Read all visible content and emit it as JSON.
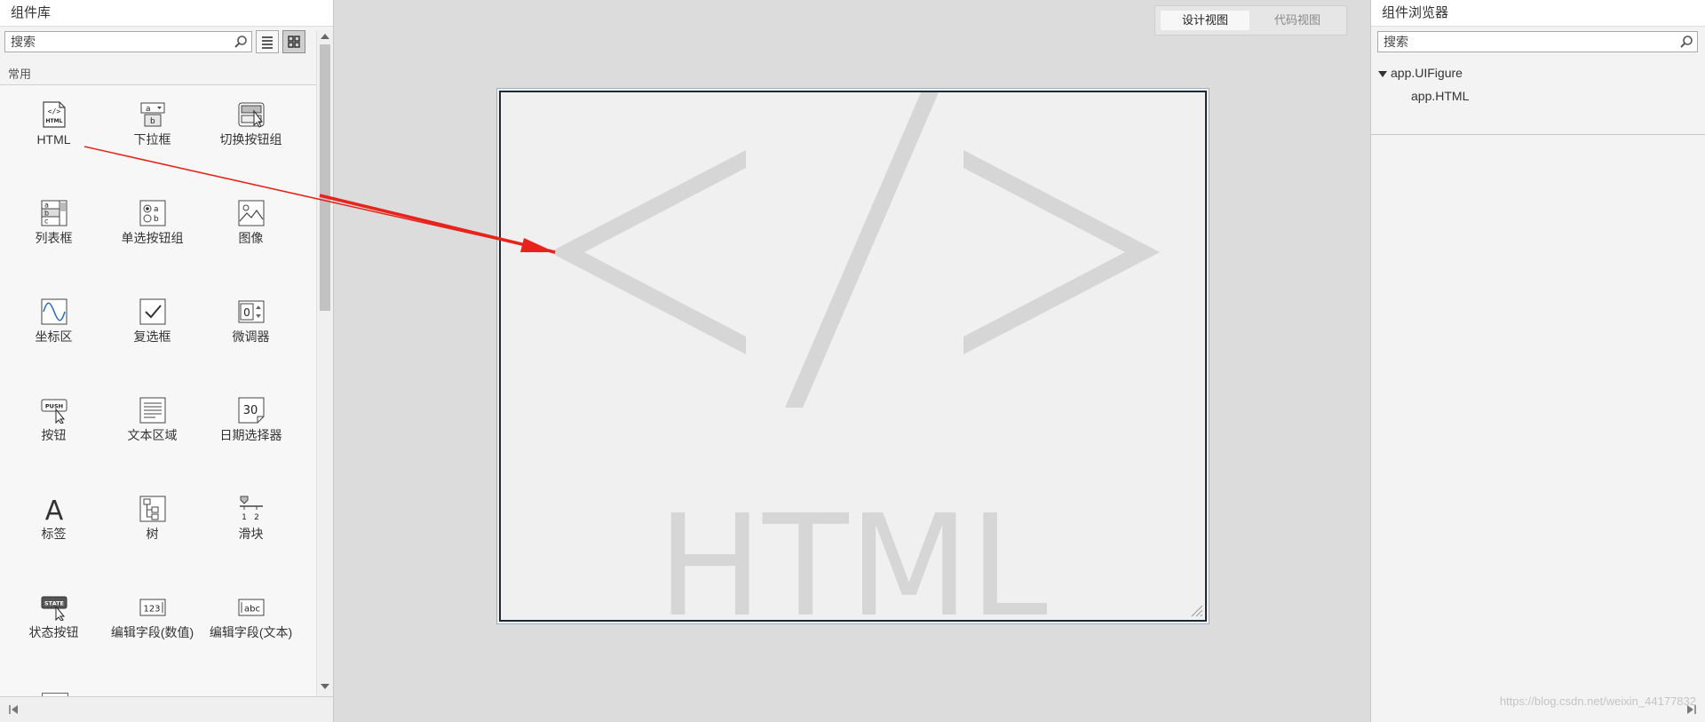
{
  "left_panel": {
    "title": "组件库",
    "search_placeholder": "搜索",
    "section_title": "常用",
    "components": [
      {
        "label": "HTML",
        "icon": "html-icon"
      },
      {
        "label": "下拉框",
        "icon": "dropdown-icon"
      },
      {
        "label": "切换按钮组",
        "icon": "toggle-button-group-icon"
      },
      {
        "label": "列表框",
        "icon": "listbox-icon"
      },
      {
        "label": "单选按钮组",
        "icon": "radio-button-group-icon"
      },
      {
        "label": "图像",
        "icon": "image-icon"
      },
      {
        "label": "坐标区",
        "icon": "axes-icon"
      },
      {
        "label": "复选框",
        "icon": "checkbox-icon"
      },
      {
        "label": "微调器",
        "icon": "spinner-icon"
      },
      {
        "label": "按钮",
        "icon": "push-button-icon"
      },
      {
        "label": "文本区域",
        "icon": "text-area-icon"
      },
      {
        "label": "日期选择器",
        "icon": "date-picker-icon"
      },
      {
        "label": "标签",
        "icon": "label-icon"
      },
      {
        "label": "树",
        "icon": "tree-icon"
      },
      {
        "label": "滑块",
        "icon": "slider-icon"
      },
      {
        "label": "状态按钮",
        "icon": "state-button-icon"
      },
      {
        "label": "编辑字段(数值)",
        "icon": "numeric-edit-field-icon"
      },
      {
        "label": "编辑字段(文本)",
        "icon": "text-edit-field-icon"
      }
    ],
    "icon_text": {
      "html": "</>",
      "html_sub": "HTML",
      "push": "PUSH",
      "state": "STATE",
      "date": "30",
      "numeric": "123",
      "text": "abc",
      "label": "A",
      "dropdown_a": "a",
      "dropdown_b": "b",
      "list_a": "a",
      "list_b": "b",
      "list_c": "c",
      "radio_a": "a",
      "radio_b": "b",
      "spinner": "0",
      "slider_1": "1",
      "slider_2": "2"
    }
  },
  "view_toggle": {
    "design_label": "设计视图",
    "code_label": "代码视图",
    "active": "design"
  },
  "canvas": {
    "placeholder_symbol": "</>",
    "placeholder_text": "HTML"
  },
  "right_panel": {
    "title": "组件浏览器",
    "search_placeholder": "搜索",
    "tree": [
      {
        "label": "app.UIFigure",
        "expanded": true
      },
      {
        "label": "app.HTML"
      }
    ]
  },
  "watermark": "https://blog.csdn.net/weixin_44177832",
  "colors": {
    "annotation_arrow": "#e8231c",
    "panel_bg": "#f3f3f3",
    "canvas_bg": "#dcdcdc",
    "placeholder_gray": "#d6d6d6"
  }
}
